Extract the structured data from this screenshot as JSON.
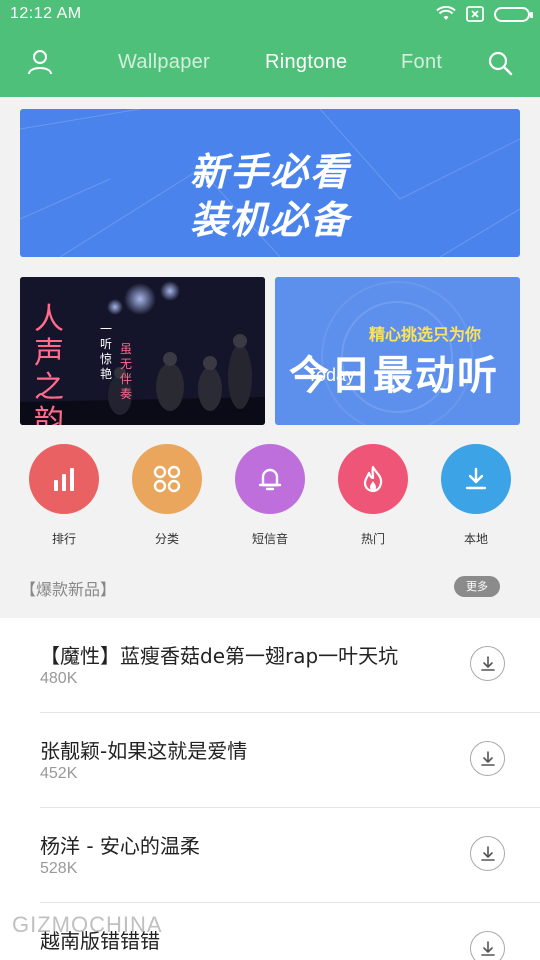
{
  "status_bar": {
    "time": "12:12  AM"
  },
  "nav": {
    "tabs": [
      {
        "label": "Wallpaper"
      },
      {
        "label": "Ringtone"
      },
      {
        "label": "Font"
      }
    ]
  },
  "banners": {
    "main": {
      "line1": "新手必看",
      "line2": "装机必备"
    },
    "left": {
      "title": "人声之韵",
      "sub1": "一听惊艳",
      "sub2": "虽无伴奏"
    },
    "right": {
      "tag": "精心挑选只为你",
      "big": "今日最动听",
      "today": "Today"
    }
  },
  "categories": [
    {
      "label": "排行",
      "color": "#e96163",
      "icon": "chart-bars-icon"
    },
    {
      "label": "分类",
      "color": "#eaa65c",
      "icon": "grid-circles-icon"
    },
    {
      "label": "短信音",
      "color": "#bf6fdc",
      "icon": "bell-icon"
    },
    {
      "label": "热门",
      "color": "#ef5577",
      "icon": "flame-icon"
    },
    {
      "label": "本地",
      "color": "#3ba3e6",
      "icon": "download-icon"
    }
  ],
  "section": {
    "title": "【爆款新品】",
    "more": "更多"
  },
  "songs": [
    {
      "name": "【魔性】蓝瘦香菇de第一翅rap一叶天坑",
      "size": "480K"
    },
    {
      "name": "张靓颖-如果这就是爱情",
      "size": "452K"
    },
    {
      "name": "杨洋 - 安心的温柔",
      "size": "528K"
    },
    {
      "name": "越南版错错错",
      "size": ""
    }
  ],
  "watermark": "GIZMOCHINA",
  "colors": {
    "accent": "#4fc07a",
    "banner_blue": "#4a83ec"
  }
}
